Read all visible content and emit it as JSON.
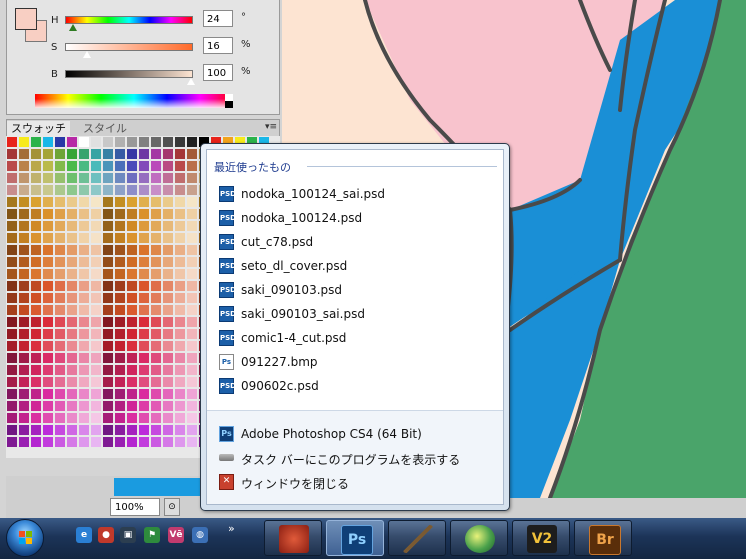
{
  "color_panel": {
    "h_label": "H",
    "h_value": "24",
    "h_unit": "°",
    "s_label": "S",
    "s_value": "16",
    "s_unit": "%",
    "b_label": "B",
    "b_value": "100",
    "b_unit": "%",
    "foreground_color": "#f8cfc3"
  },
  "swatches_panel": {
    "tab_active": "スウォッチ",
    "tab_inactive": "スタイル",
    "menu_glyph": "▾≡"
  },
  "status_bar": {
    "zoom": "100%"
  },
  "jumplist": {
    "header": "最近使ったもの",
    "recent": [
      {
        "label": "nodoka_100124_sai.psd",
        "icon": "psd-file-icon"
      },
      {
        "label": "nodoka_100124.psd",
        "icon": "psd-file-icon"
      },
      {
        "label": "cut_c78.psd",
        "icon": "psd-file-icon"
      },
      {
        "label": "seto_dl_cover.psd",
        "icon": "psd-file-icon"
      },
      {
        "label": "saki_090103.psd",
        "icon": "psd-file-icon"
      },
      {
        "label": "saki_090103_sai.psd",
        "icon": "psd-file-icon"
      },
      {
        "label": "comic1-4_cut.psd",
        "icon": "psd-file-icon"
      },
      {
        "label": "091227.bmp",
        "icon": "bmp-file-icon"
      },
      {
        "label": "090602c.psd",
        "icon": "psd-file-icon"
      }
    ],
    "tasks": {
      "app": "Adobe Photoshop CS4 (64 Bit)",
      "pin": "タスク バーにこのプログラムを表示する",
      "close": "ウィンドウを閉じる"
    }
  },
  "taskbar": {
    "quicklaunch_more": "»",
    "quicklaunch": [
      {
        "glyph": "e",
        "color": "#2a7fd4"
      },
      {
        "glyph": "●",
        "color": "#c0392b"
      },
      {
        "glyph": "▣",
        "color": "#2c3e50"
      },
      {
        "glyph": "⚑",
        "color": "#2e8b3d"
      },
      {
        "glyph": "Vē",
        "color": "#c23b6e"
      },
      {
        "glyph": "◍",
        "color": "#3b6fb5"
      }
    ],
    "buttons": [
      {
        "glyph": "",
        "name": "taskbar-app-red"
      },
      {
        "glyph": "Ps",
        "name": "taskbar-photoshop"
      },
      {
        "glyph": "",
        "name": "taskbar-brush"
      },
      {
        "glyph": "",
        "name": "taskbar-gradient"
      },
      {
        "glyph": "V2",
        "name": "taskbar-v2"
      },
      {
        "glyph": "Br",
        "name": "taskbar-bridge"
      }
    ]
  }
}
